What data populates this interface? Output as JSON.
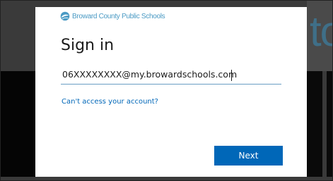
{
  "branding": {
    "org_name": "Broward County Public Schools",
    "logo_icon": "globe-swirl-icon"
  },
  "background": {
    "partial_text": "to"
  },
  "signin": {
    "title": "Sign in",
    "email_value": "06XXXXXXXX@my.browardschools.com",
    "cant_access_label": "Can't access your account?",
    "next_label": "Next"
  },
  "colors": {
    "accent": "#0067b8",
    "brand_logo": "#4a9ac4",
    "input_underline": "#6a9ec4"
  }
}
